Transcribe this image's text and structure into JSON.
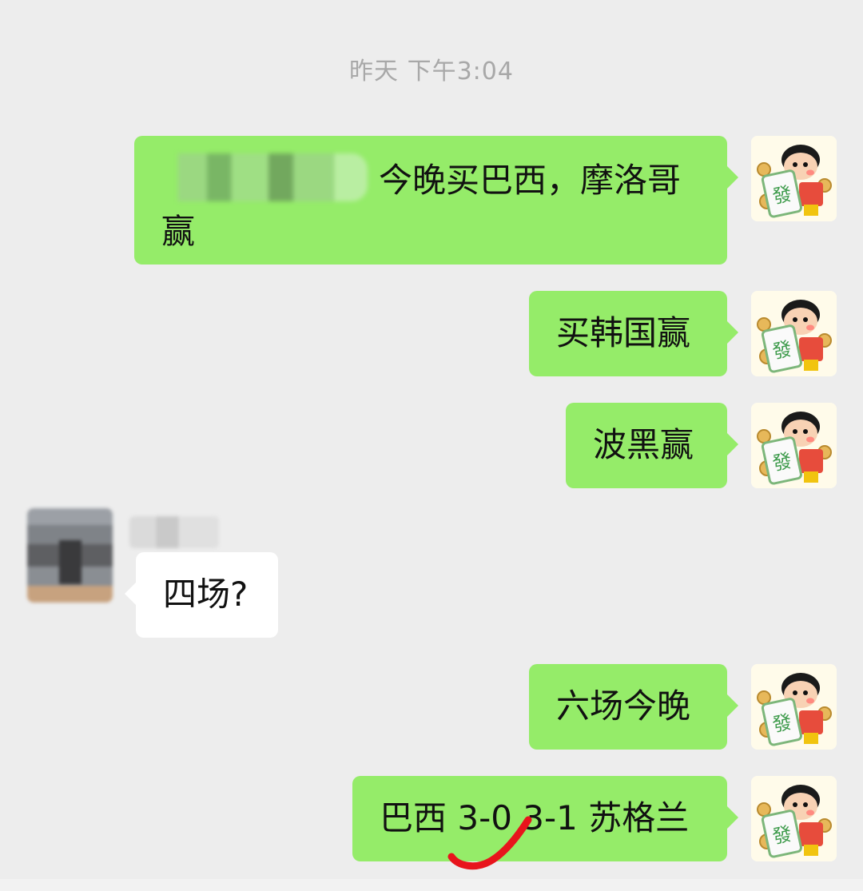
{
  "timestamp": "昨天 下午3:04",
  "messages": [
    {
      "direction": "out",
      "text": "今晚买巴西，摩洛哥赢",
      "line1": "今晚买巴西，摩洛哥",
      "line2": "赢"
    },
    {
      "direction": "out",
      "text": "买韩国赢"
    },
    {
      "direction": "out",
      "text": "波黑赢"
    },
    {
      "direction": "in",
      "text": "四场?"
    },
    {
      "direction": "out",
      "text": "六场今晚"
    },
    {
      "direction": "out",
      "text": "巴西 3-0 3-1 苏格兰"
    }
  ],
  "colors": {
    "background": "#ededed",
    "outgoing_bubble": "#95ec69",
    "incoming_bubble": "#ffffff",
    "timestamp_text": "#a8a8a8",
    "annotation_mark": "#e8141c"
  },
  "icons": {
    "self_avatar": "cartoon-mahjong-tile-avatar-icon",
    "other_avatar": "blurred-photo-avatar",
    "annotation": "red-checkmark-annotation"
  }
}
